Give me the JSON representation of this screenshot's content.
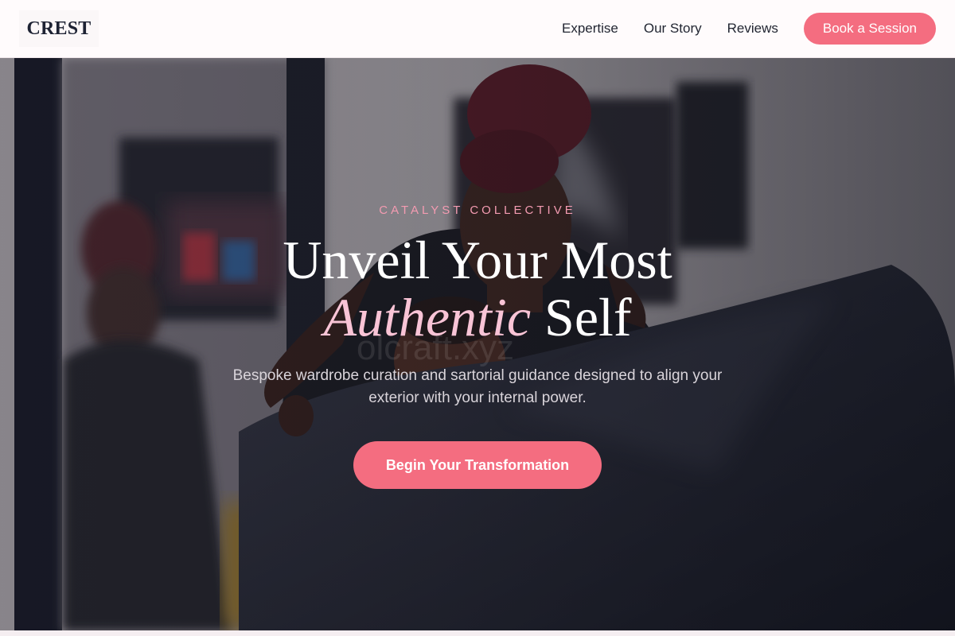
{
  "nav": {
    "logo": "CREST",
    "links": [
      "Expertise",
      "Our Story",
      "Reviews"
    ],
    "cta": "Book a Session"
  },
  "hero": {
    "eyebrow": "CATALYST COLLECTIVE",
    "headline_line1": "Unveil Your Most",
    "headline_accent": "Authentic",
    "headline_line2_rest": " Self",
    "subtext": "Bespoke wardrobe curation and sartorial guidance designed to align your exterior with your internal power.",
    "cta": "Begin Your Transformation",
    "watermark": "olcraft.xyz",
    "image": "salon-stylist-photo"
  },
  "colors": {
    "accent": "#f46d80",
    "accent_light": "#f9c4d6",
    "eyebrow": "#f39bb1",
    "logo": "#1d2233"
  }
}
